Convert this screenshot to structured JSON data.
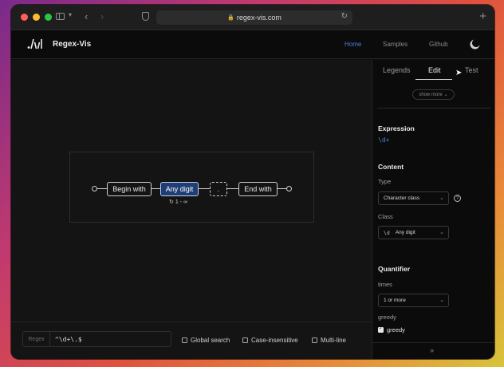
{
  "browser": {
    "url": "regex-vis.com",
    "colors": {
      "close": "#ff5f57",
      "minimize": "#febc2e",
      "maximize": "#28c840"
    }
  },
  "header": {
    "brand": "Regex-Vis",
    "nav": [
      {
        "label": "Home",
        "active": true
      },
      {
        "label": "Samples",
        "active": false
      },
      {
        "label": "Github",
        "active": false
      }
    ]
  },
  "graph": {
    "nodes": [
      {
        "label": "Begin with"
      },
      {
        "label": "Any digit",
        "selected": true
      },
      {
        "label": "."
      },
      {
        "label": "End with"
      }
    ],
    "quantifier": "1 - ∞"
  },
  "regex_bar": {
    "label": "Regex",
    "value": "^\\d+\\.$",
    "flags": [
      {
        "label": "Global search",
        "checked": false
      },
      {
        "label": "Case-insensitive",
        "checked": false
      },
      {
        "label": "Multi-line",
        "checked": false
      }
    ]
  },
  "panel": {
    "tabs": [
      {
        "label": "Legends",
        "active": false
      },
      {
        "label": "Edit",
        "active": true
      },
      {
        "label": "Test",
        "active": false
      }
    ],
    "show_more": "show more",
    "expression_title": "Expression",
    "expression_value": "\\d+",
    "content_title": "Content",
    "type_label": "Type",
    "type_value": "Character class",
    "class_label": "Class",
    "class_code": "\\d",
    "class_value": "Any digit",
    "quantifier_title": "Quantifier",
    "times_label": "times",
    "times_value": "1 or more",
    "greedy_label": "greedy",
    "greedy_checkbox_label": "greedy",
    "greedy_checked": true,
    "collapse_icon": "»"
  }
}
